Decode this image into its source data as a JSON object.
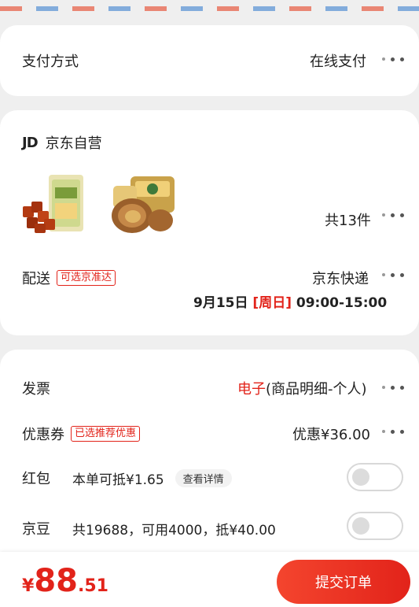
{
  "payment": {
    "label": "支付方式",
    "value": "在线支付"
  },
  "shop": {
    "logo": "JD",
    "name": "京东自营",
    "products": [
      {
        "icon": "beef-jerky-pack-image"
      },
      {
        "icon": "braised-egg-pack-image"
      }
    ],
    "count": "共13件",
    "delivery_label": "配送",
    "delivery_tag": "可选京准达",
    "delivery_method": "京东快递",
    "delivery_date": "9月15日",
    "delivery_weekday": "[周日]",
    "delivery_time": "09:00-15:00"
  },
  "invoice": {
    "label": "发票",
    "type": "电子",
    "detail": "(商品明细-个人)"
  },
  "coupon": {
    "label": "优惠券",
    "tag": "已选推荐优惠",
    "value": "优惠¥36.00"
  },
  "redpacket": {
    "label": "红包",
    "value": "本单可抵¥1.65",
    "detail_btn": "查看详情",
    "enabled": false
  },
  "jingdou": {
    "label": "京豆",
    "value": "共19688，可用4000，抵¥40.00",
    "enabled": false
  },
  "footer": {
    "currency": "¥",
    "price_int": "88",
    "price_dec": ".51",
    "submit_label": "提交订单"
  },
  "colors": {
    "accent": "#e2231a",
    "background": "#efefef"
  }
}
